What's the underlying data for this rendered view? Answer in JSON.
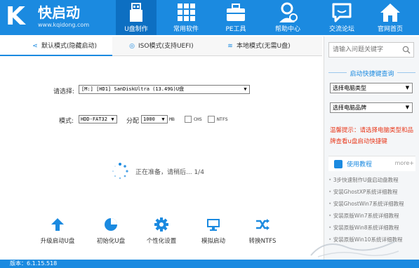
{
  "header": {
    "logo_title": "快启动",
    "logo_url": "www.kqidong.com",
    "nav": [
      {
        "label": "U盘制作",
        "icon": "usb-drive-icon",
        "active": true
      },
      {
        "label": "常用软件",
        "icon": "apps-grid-icon",
        "active": false
      },
      {
        "label": "PE工具",
        "icon": "toolbox-icon",
        "active": false
      },
      {
        "label": "帮助中心",
        "icon": "help-person-icon",
        "active": false
      },
      {
        "label": "交流论坛",
        "icon": "chat-bubble-icon",
        "active": false
      },
      {
        "label": "官网首页",
        "icon": "home-icon",
        "active": false
      }
    ]
  },
  "tabs": [
    {
      "label": "默认模式(隐藏启动)",
      "icon": "share-icon",
      "active": true
    },
    {
      "label": "ISO模式(支持UEFI)",
      "icon": "disc-icon",
      "active": false
    },
    {
      "label": "本地模式(无需U盘)",
      "icon": "wifi-icon",
      "active": false
    }
  ],
  "main": {
    "select_label": "请选择:",
    "device_value": "[M:] [HD1] SanDiskUltra (13.49G)U盘",
    "mode_label": "模式:",
    "mode_value": "HDD-FAT32",
    "partition_label": "分配",
    "partition_value": "1000",
    "partition_unit": "MB",
    "chs_label": "CHS",
    "ntfs_label": "NTFS",
    "progress_text": "正在准备，请稍后... 1/4"
  },
  "tools": [
    {
      "label": "升级启动U盘",
      "icon": "upgrade-arrow-icon"
    },
    {
      "label": "初始化U盘",
      "icon": "format-disk-icon"
    },
    {
      "label": "个性化设置",
      "icon": "settings-gear-icon"
    },
    {
      "label": "模拟启动",
      "icon": "monitor-icon"
    },
    {
      "label": "转换NTFS",
      "icon": "shuffle-icon"
    }
  ],
  "sidebar": {
    "search_placeholder": "请输入问题关键字",
    "hotkey_title": "启动快捷键查询",
    "computer_type": "选择电脑类型",
    "computer_brand": "选择电脑品牌",
    "tip": "温馨提示：请选择电脑类型和品牌查看u盘启动快捷键",
    "tutorial_title": "使用教程",
    "more_label": "more+",
    "tutorials": [
      "3步快速制作U盘启动盘教程",
      "安装GhostXP系统详细教程",
      "安装GhostWin7系统详细教程",
      "安装原版Win7系统详细教程",
      "安装原版Win8系统详细教程",
      "安装原版Win10系统详细教程"
    ]
  },
  "status": {
    "version": "版本：6.1.15.518"
  },
  "colors": {
    "brand_blue": "#1b8ae0",
    "active_nav": "#0d6fc2",
    "tip_red": "#e8381b"
  }
}
